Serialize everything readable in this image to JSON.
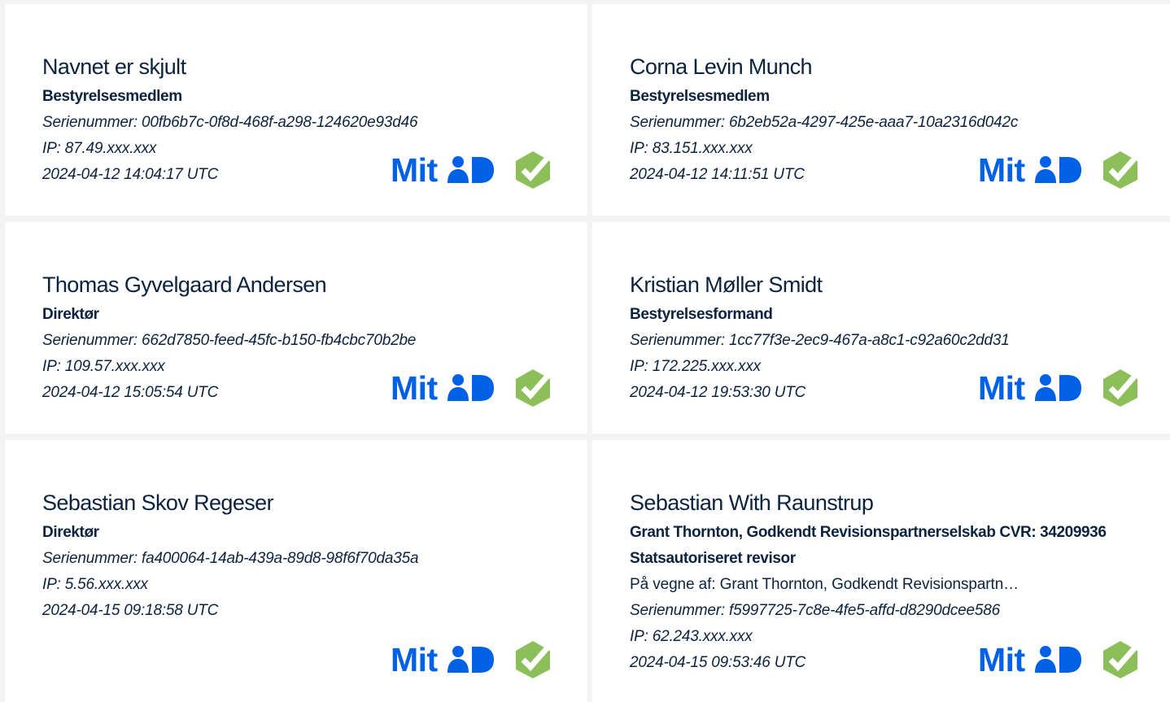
{
  "colors": {
    "mitid_blue": "#0060e6",
    "check_green": "#8cbf5a",
    "text_navy": "#0c2340",
    "card_bg": "#ffffff",
    "page_bg": "#f3f3f3"
  },
  "signers": [
    {
      "name": "Navnet er skjult",
      "role": "Bestyrelsesmedlem",
      "serial": "Serienummer: 00fb6b7c-0f8d-468f-a298-124620e93d46",
      "ip": "IP: 87.49.xxx.xxx",
      "timestamp": "2024-04-12 14:04:17 UTC",
      "logo_text": "Mit",
      "logo_icon": "mitid-person-icon",
      "status_icon": "verified-check-icon"
    },
    {
      "name": "Corna Levin Munch",
      "role": "Bestyrelsesmedlem",
      "serial": "Serienummer: 6b2eb52a-4297-425e-aaa7-10a2316d042c",
      "ip": "IP: 83.151.xxx.xxx",
      "timestamp": "2024-04-12 14:11:51 UTC",
      "logo_text": "Mit",
      "logo_icon": "mitid-person-icon",
      "status_icon": "verified-check-icon"
    },
    {
      "name": "Thomas Gyvelgaard Andersen",
      "role": "Direktør",
      "serial": "Serienummer: 662d7850-feed-45fc-b150-fb4cbc70b2be",
      "ip": "IP: 109.57.xxx.xxx",
      "timestamp": "2024-04-12 15:05:54 UTC",
      "logo_text": "Mit",
      "logo_icon": "mitid-person-icon",
      "status_icon": "verified-check-icon"
    },
    {
      "name": "Kristian Møller Smidt",
      "role": "Bestyrelsesformand",
      "serial": "Serienummer: 1cc77f3e-2ec9-467a-a8c1-c92a60c2dd31",
      "ip": "IP: 172.225.xxx.xxx",
      "timestamp": "2024-04-12 19:53:30 UTC",
      "logo_text": "Mit",
      "logo_icon": "mitid-person-icon",
      "status_icon": "verified-check-icon"
    },
    {
      "name": "Sebastian Skov Regeser",
      "role": "Direktør",
      "serial": "Serienummer: fa400064-14ab-439a-89d8-98f6f70da35a",
      "ip": "IP: 5.56.xxx.xxx",
      "timestamp": "2024-04-15 09:18:58 UTC",
      "logo_text": "Mit",
      "logo_icon": "mitid-person-icon",
      "status_icon": "verified-check-icon"
    },
    {
      "name": "Sebastian With Raunstrup",
      "company": "Grant Thornton, Godkendt Revisionspartnerselskab CVR: 34209936",
      "role": "Statsautoriseret revisor",
      "on_behalf": "På vegne af: Grant Thornton, Godkendt Revisionspartn…",
      "serial": "Serienummer: f5997725-7c8e-4fe5-affd-d8290dcee586",
      "ip": "IP: 62.243.xxx.xxx",
      "timestamp": "2024-04-15 09:53:46 UTC",
      "logo_text": "Mit",
      "logo_icon": "mitid-person-icon",
      "status_icon": "verified-check-icon"
    }
  ]
}
